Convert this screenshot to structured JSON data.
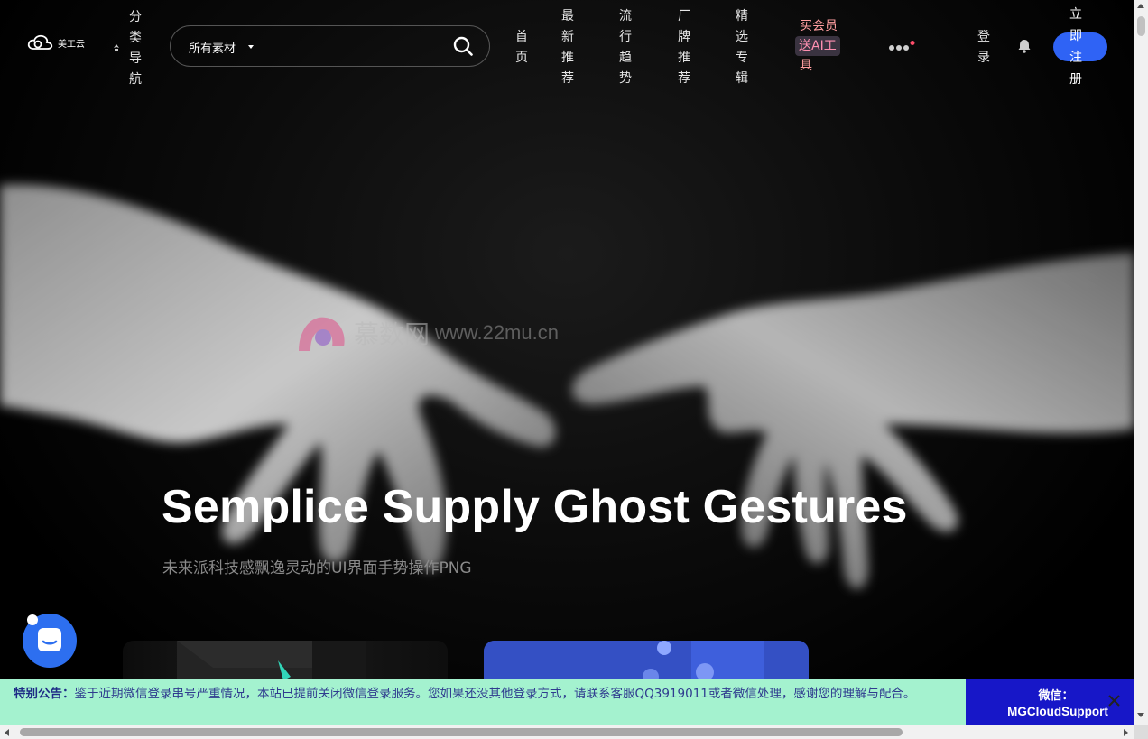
{
  "header": {
    "logo_text": "美工云",
    "category_nav": "分类导航",
    "search": {
      "scope": "所有素材",
      "placeholder": ""
    },
    "nav": [
      {
        "label": "首页"
      },
      {
        "label": "最新推荐"
      },
      {
        "label": "流行趋势"
      },
      {
        "label": "厂牌推荐"
      },
      {
        "label": "精选专辑"
      }
    ],
    "vip": {
      "line1": "买会员",
      "line2": "送AI工",
      "line3": "具"
    },
    "login": "登录",
    "register": "立即注册"
  },
  "hero": {
    "title": "Semplice Supply Ghost Gestures",
    "subtitle": "未来派科技感飘逸灵动的UI界面手势操作PNG",
    "watermark_cn": "慕数网",
    "watermark_url": "www.22mu.cn"
  },
  "notice": {
    "label": "特别公告：",
    "text": "鉴于近期微信登录串号严重情况，本站已提前关闭微信登录服务。您如果还没其他登录方式，请联系客服QQ3919011或者微信处理，感谢您的理解与配合。",
    "wechat_label": "微信：",
    "wechat_id": "MGCloudSupport"
  },
  "colors": {
    "accent": "#2f63f5",
    "notice_bg": "#a4f2cf",
    "wechat_bg": "#1717c8",
    "vip_text": "#ff9ea0"
  },
  "icons": [
    "cloud-logo-icon",
    "category-nav-icon",
    "caret-down-icon",
    "search-icon",
    "more-dots-icon",
    "notification-dot-icon",
    "bell-icon",
    "chat-icon",
    "close-icon"
  ]
}
